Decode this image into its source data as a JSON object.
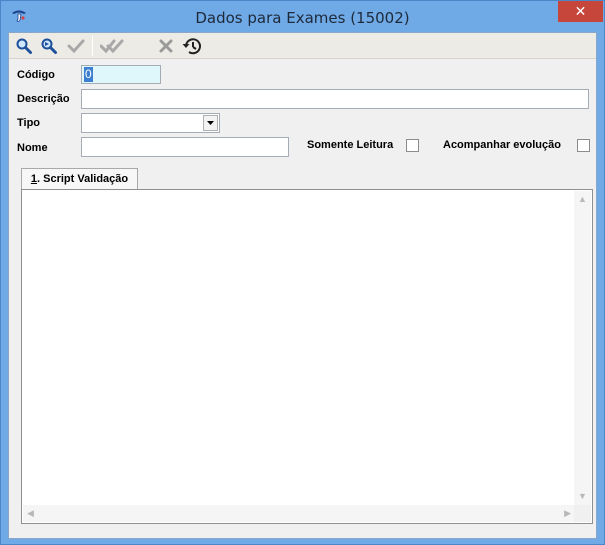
{
  "window": {
    "title": "Dados para Exames (15002)",
    "close_glyph": "✕"
  },
  "toolbar": {
    "buttons": [
      {
        "name": "search-icon",
        "enabled": true
      },
      {
        "name": "search-next-icon",
        "enabled": true
      },
      {
        "name": "check-icon",
        "enabled": false
      },
      {
        "name": "double-check-icon",
        "enabled": false
      },
      {
        "name": "cancel-icon",
        "enabled": false
      },
      {
        "name": "history-icon",
        "enabled": true
      }
    ]
  },
  "form": {
    "codigo_label": "Código",
    "codigo_value": "0",
    "descricao_label": "Descrição",
    "descricao_value": "",
    "tipo_label": "Tipo",
    "tipo_value": "",
    "nome_label": "Nome",
    "nome_value": "",
    "somente_leitura_label": "Somente Leitura",
    "somente_leitura_checked": false,
    "acompanhar_label": "Acompanhar evolução",
    "acompanhar_checked": false
  },
  "tabs": [
    {
      "mnemonic": "1",
      "label": ". Script Validação",
      "active": true
    }
  ],
  "script": {
    "value": ""
  },
  "colors": {
    "titlebar": "#6fa9e6",
    "close": "#c7463c",
    "selection": "#3d7fd0",
    "code_field_bg": "#dff6fb"
  }
}
